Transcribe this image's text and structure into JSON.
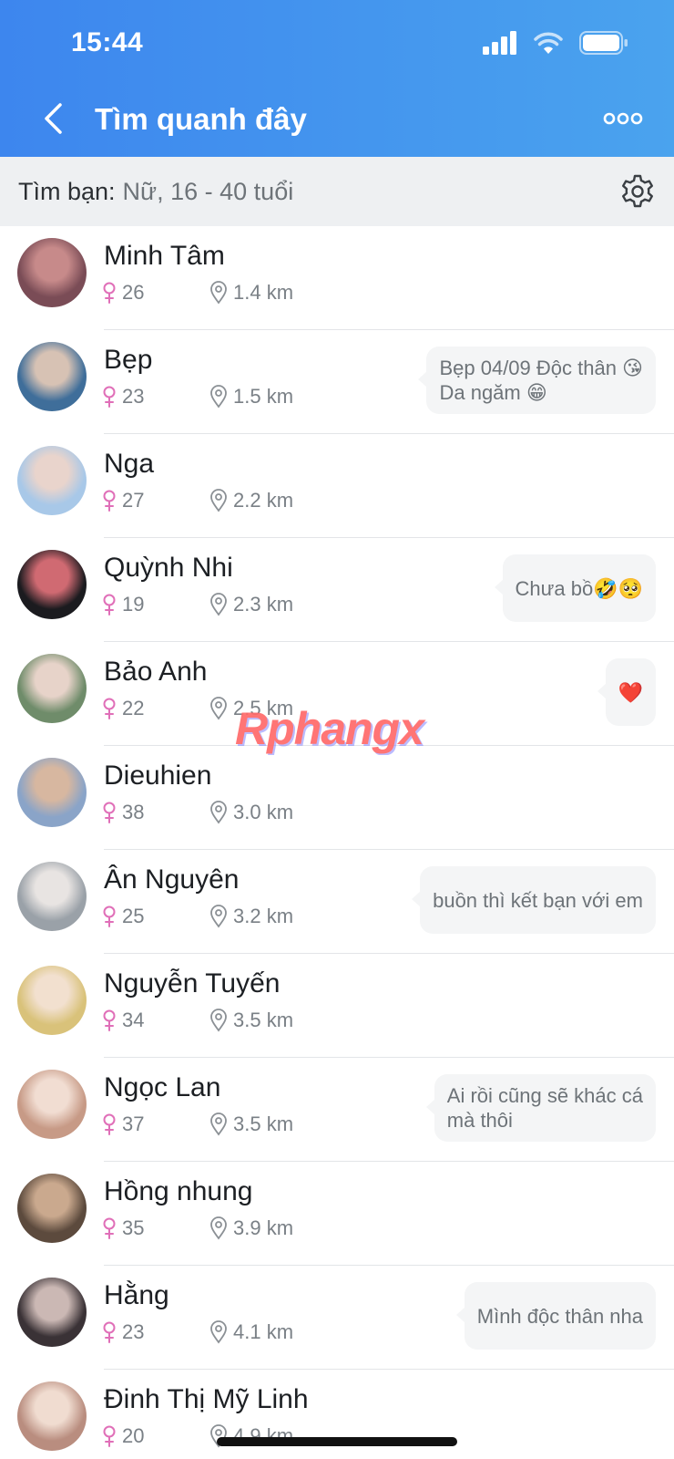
{
  "status_bar": {
    "time": "15:44"
  },
  "nav": {
    "title": "Tìm quanh đây"
  },
  "filter": {
    "label": "Tìm bạn:",
    "value": "Nữ, 16 - 40 tuổi"
  },
  "watermark": "Rphangx",
  "colors": {
    "header_start": "#3d86ee",
    "header_end": "#4aa3ee",
    "female_icon": "#e06fb8"
  },
  "people": [
    {
      "name": "Minh Tâm",
      "age": "26",
      "distance": "1.4 km",
      "status": ""
    },
    {
      "name": "Bẹp",
      "age": "23",
      "distance": "1.5 km",
      "status": "Bẹp 04/09  Độc thân 😘\nDa ngăm 😁"
    },
    {
      "name": "Nga",
      "age": "27",
      "distance": "2.2 km",
      "status": ""
    },
    {
      "name": "Quỳnh Nhi",
      "age": "19",
      "distance": "2.3 km",
      "status": "Chưa bồ🤣🥺"
    },
    {
      "name": "Bảo Anh",
      "age": "22",
      "distance": "2.5 km",
      "status": "❤️"
    },
    {
      "name": "Dieuhien",
      "age": "38",
      "distance": "3.0 km",
      "status": ""
    },
    {
      "name": "Ân Nguyên",
      "age": "25",
      "distance": "3.2 km",
      "status": "buồn thì kết bạn với em"
    },
    {
      "name": "Nguyễn Tuyến",
      "age": "34",
      "distance": "3.5 km",
      "status": ""
    },
    {
      "name": "Ngọc Lan",
      "age": "37",
      "distance": "3.5 km",
      "status": "Ai rồi cũng sẽ khác cá\nmà thôi"
    },
    {
      "name": "Hồng nhung",
      "age": "35",
      "distance": "3.9 km",
      "status": ""
    },
    {
      "name": "Hằng",
      "age": "23",
      "distance": "4.1 km",
      "status": "Mình độc thân nha"
    },
    {
      "name": "Đinh Thị Mỹ Linh",
      "age": "20",
      "distance": "4.9 km",
      "status": ""
    }
  ]
}
